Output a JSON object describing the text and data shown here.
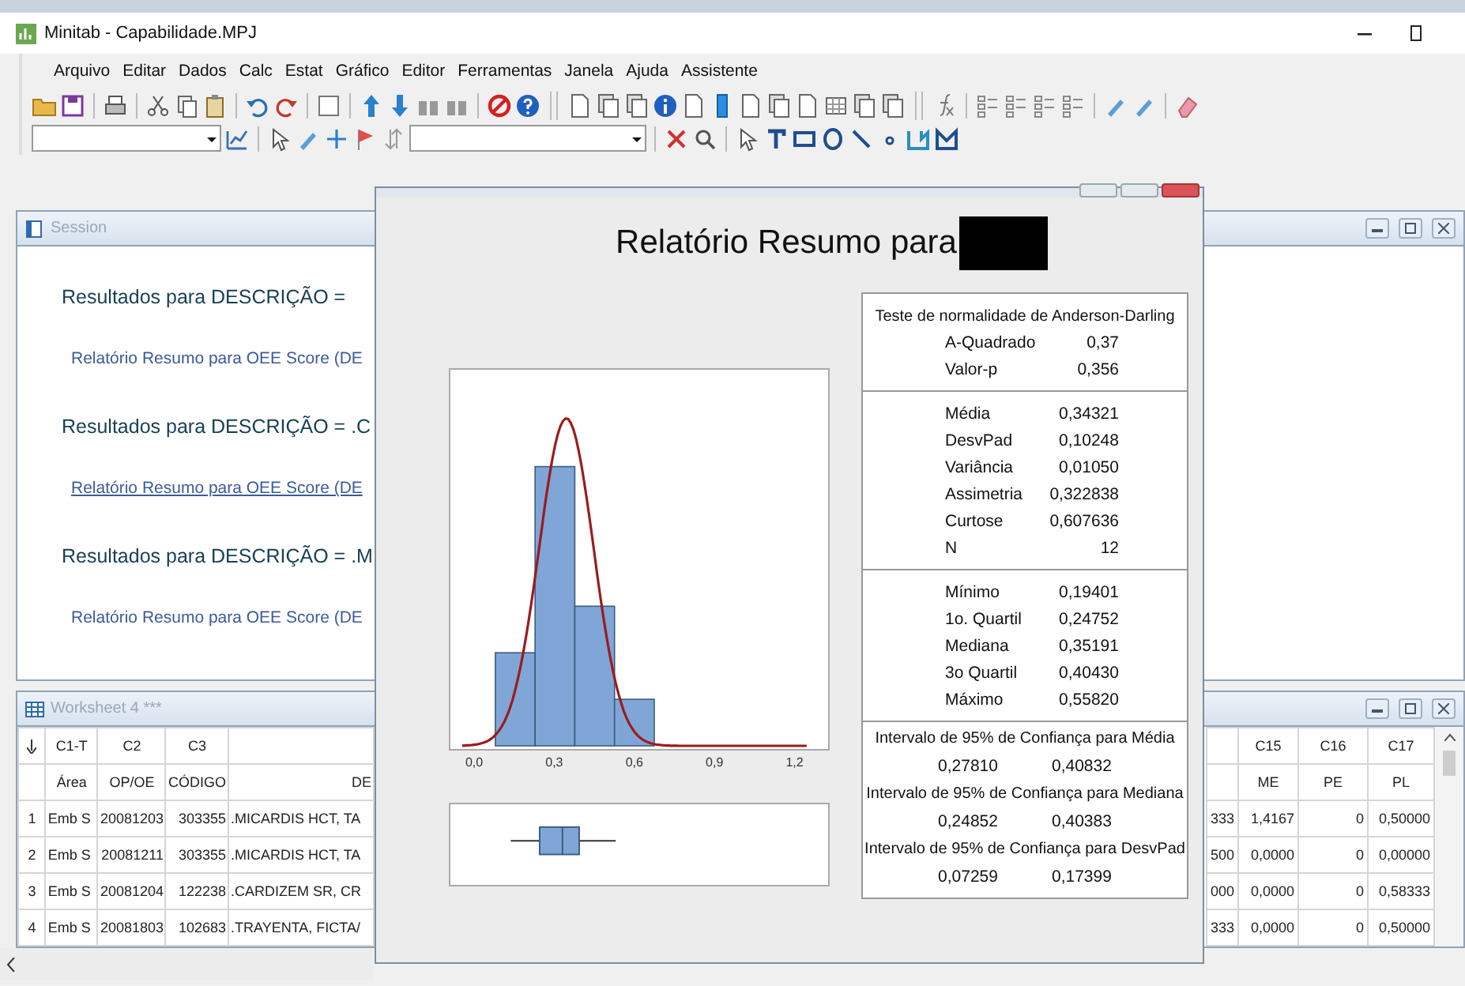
{
  "window": {
    "title": "Minitab - Capabilidade.MPJ"
  },
  "menu": [
    "Arquivo",
    "Editar",
    "Dados",
    "Calc",
    "Estat",
    "Gráfico",
    "Editor",
    "Ferramentas",
    "Janela",
    "Ajuda",
    "Assistente"
  ],
  "session": {
    "title": "Session",
    "entries": [
      {
        "kind": "heading",
        "text": "Resultados para DESCRIÇÃO ="
      },
      {
        "kind": "link",
        "text": "Relatório Resumo para OEE Score (DE",
        "underlined": false
      },
      {
        "kind": "heading",
        "text": "Resultados para DESCRIÇÃO = .C"
      },
      {
        "kind": "link",
        "text": "Relatório Resumo para OEE Score (DE",
        "underlined": true
      },
      {
        "kind": "heading",
        "text": "Resultados para DESCRIÇÃO = .M"
      },
      {
        "kind": "link",
        "text": "Relatório Resumo para OEE Score (DE",
        "underlined": false
      }
    ]
  },
  "graph": {
    "title": "Relatório Resumo para",
    "x_ticks": [
      "0,0",
      "0,3",
      "0,6",
      "0,9",
      "1,2"
    ],
    "normality": {
      "heading": "Teste de normalidade de Anderson-Darling",
      "rows": [
        [
          "A-Quadrado",
          "0,37"
        ],
        [
          "Valor-p",
          "0,356"
        ]
      ]
    },
    "moments": [
      [
        "Média",
        "0,34321"
      ],
      [
        "DesvPad",
        "0,10248"
      ],
      [
        "Variância",
        "0,01050"
      ],
      [
        "Assimetria",
        "0,322838"
      ],
      [
        "Curtose",
        "0,607636"
      ],
      [
        "N",
        "12"
      ]
    ],
    "quartiles": [
      [
        "Mínimo",
        "0,19401"
      ],
      [
        "1o. Quartil",
        "0,24752"
      ],
      [
        "Mediana",
        "0,35191"
      ],
      [
        "3o Quartil",
        "0,40430"
      ],
      [
        "Máximo",
        "0,55820"
      ]
    ],
    "intervals": [
      {
        "heading": "Intervalo de 95% de Confiança para Média",
        "low": "0,27810",
        "high": "0,40832"
      },
      {
        "heading": "Intervalo de 95% de Confiança para Mediana",
        "low": "0,24852",
        "high": "0,40383"
      },
      {
        "heading": "Intervalo de 95% de Confiança para DesvPad",
        "low": "0,07259",
        "high": "0,17399"
      }
    ]
  },
  "worksheet": {
    "title": "Worksheet 4 ***",
    "left_columns": [
      {
        "id": "C1-T",
        "name": "Área"
      },
      {
        "id": "C2",
        "name": "OP/OE"
      },
      {
        "id": "C3",
        "name": "CÓDIGO"
      },
      {
        "name": "DE"
      }
    ],
    "left_rows": [
      {
        "number": "1",
        "cells": [
          "Emb S",
          "20081203",
          "303355",
          ".MICARDIS HCT, TA"
        ]
      },
      {
        "number": "2",
        "cells": [
          "Emb S",
          "20081211",
          "303355",
          ".MICARDIS HCT, TA"
        ]
      },
      {
        "number": "3",
        "cells": [
          "Emb S",
          "20081204",
          "122238",
          ".CARDIZEM SR, CR"
        ]
      },
      {
        "number": "4",
        "cells": [
          "Emb S",
          "20081803",
          "102683",
          ".TRAYENTA, FICTA/"
        ]
      }
    ],
    "right_columns": [
      {},
      {
        "id": "C15",
        "name": "ME"
      },
      {
        "id": "C16",
        "name": "PE"
      },
      {
        "id": "C17",
        "name": "PL"
      }
    ],
    "right_rows": [
      [
        "333",
        "1,4167",
        "0",
        "0,50000"
      ],
      [
        "500",
        "0,0000",
        "0",
        "0,00000"
      ],
      [
        "000",
        "0,0000",
        "0",
        "0,58333"
      ],
      [
        "333",
        "0,0000",
        "0",
        "0,50000"
      ]
    ]
  }
}
